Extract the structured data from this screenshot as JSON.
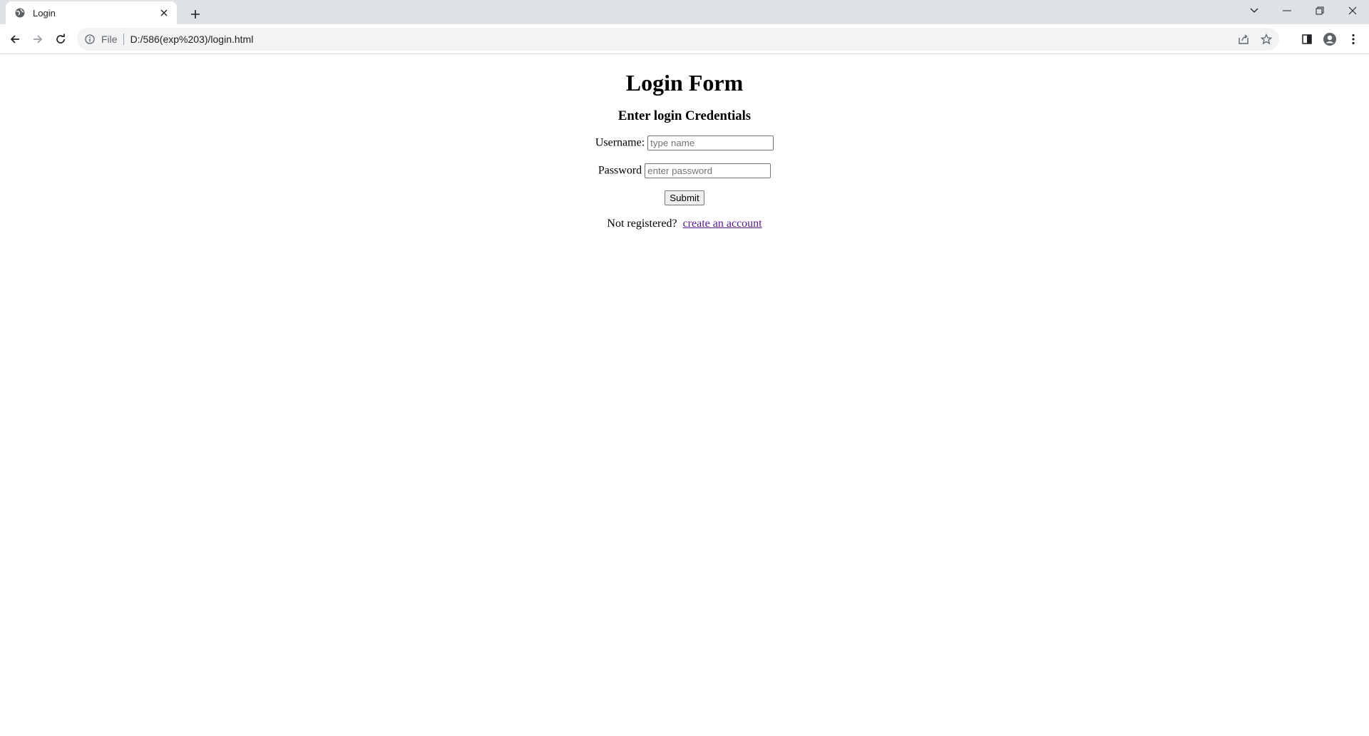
{
  "browser": {
    "tab": {
      "title": "Login"
    },
    "omnibox": {
      "scheme": "File",
      "url": "D:/586(exp%203)/login.html"
    }
  },
  "page": {
    "heading": "Login Form",
    "subheading": "Enter login Credentials",
    "username": {
      "label": "Username:",
      "placeholder": "type name"
    },
    "password": {
      "label": "Password",
      "placeholder": "enter password"
    },
    "submit_label": "Submit",
    "register": {
      "prompt": "Not registered? ",
      "link_text": "create an account"
    }
  },
  "colors": {
    "link_visited": "#551a8b",
    "tabstrip_bg": "#dee1e6",
    "omnibox_bg": "#f1f3f4"
  }
}
